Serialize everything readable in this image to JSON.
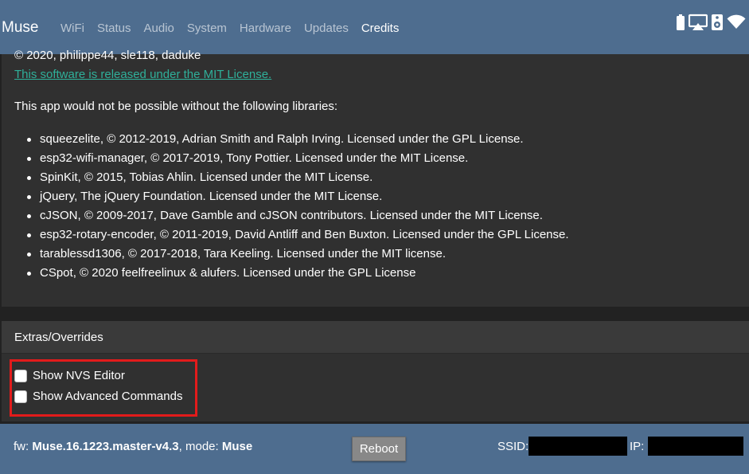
{
  "navbar": {
    "brand": "Muse",
    "links": [
      {
        "label": "WiFi",
        "active": false
      },
      {
        "label": "Status",
        "active": false
      },
      {
        "label": "Audio",
        "active": false
      },
      {
        "label": "System",
        "active": false
      },
      {
        "label": "Hardware",
        "active": false
      },
      {
        "label": "Updates",
        "active": false
      },
      {
        "label": "Credits",
        "active": true
      }
    ],
    "icons": [
      "battery-icon",
      "airplay-icon",
      "speaker-icon",
      "wifi-icon"
    ]
  },
  "credits": {
    "cut_line": "© 2020, philippe44, sle118, daduke",
    "license_link": "This software is released under the MIT License.",
    "intro": "This app would not be possible without the following libraries:",
    "libraries": [
      "squeezelite, © 2012-2019, Adrian Smith and Ralph Irving. Licensed under the GPL License.",
      "esp32-wifi-manager, © 2017-2019, Tony Pottier. Licensed under the MIT License.",
      "SpinKit, © 2015, Tobias Ahlin. Licensed under the MIT License.",
      "jQuery, The jQuery Foundation. Licensed under the MIT License.",
      "cJSON, © 2009-2017, Dave Gamble and cJSON contributors. Licensed under the MIT License.",
      "esp32-rotary-encoder, © 2011-2019, David Antliff and Ben Buxton. Licensed under the GPL License.",
      "tarablessd1306, © 2017-2018, Tara Keeling. Licensed under the MIT license.",
      "CSpot, © 2020 feelfreelinux & alufers. Licensed under the GPL License"
    ]
  },
  "extras": {
    "header": "Extras/Overrides",
    "show_nvs_editor": "Show NVS Editor",
    "show_advanced_commands": "Show Advanced Commands"
  },
  "footer": {
    "fw_prefix": "fw: ",
    "fw_version": "Muse.16.1223.master-v4.3",
    "mode_prefix": ", mode: ",
    "mode": "Muse",
    "reboot_label": "Reboot",
    "ssid_label": "SSID:",
    "ip_label": "IP:"
  },
  "colors": {
    "navbar": "#4e6d8f",
    "background": "#222222",
    "card": "#303030",
    "link": "#2fb09a",
    "highlight": "#e21b1b"
  }
}
